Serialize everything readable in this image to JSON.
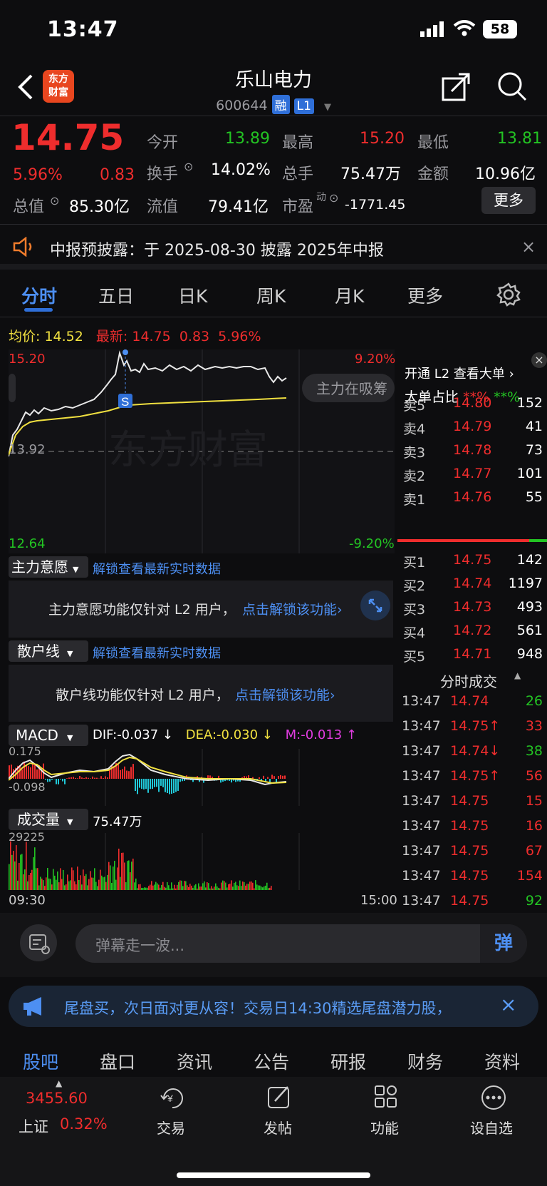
{
  "status": {
    "time": "13:47",
    "battery": "58"
  },
  "header": {
    "title": "乐山电力",
    "code": "600644",
    "tag1": "融",
    "tag2": "L1"
  },
  "quote": {
    "price": "14.75",
    "pct": "5.96%",
    "chg": "0.83",
    "open_label": "今开",
    "open": "13.89",
    "high_label": "最高",
    "high": "15.20",
    "low_label": "最低",
    "low": "13.81",
    "turnover_label": "换手",
    "turnover": "14.02%",
    "vol_label": "总手",
    "vol": "75.47万",
    "amt_label": "金额",
    "amt": "10.96亿",
    "mcap_label": "总值",
    "mcap": "85.30亿",
    "float_label": "流值",
    "float": "79.41亿",
    "pe_label": "市盈",
    "pe_sup": "动",
    "pe": "-1771.45",
    "more": "更多"
  },
  "notice": {
    "text": "中报预披露：于 2025-08-30 披露 2025年中报"
  },
  "tabs": [
    "分时",
    "五日",
    "日K",
    "周K",
    "月K",
    "更多"
  ],
  "chartinfo": {
    "avg_label": "均价:",
    "avg": "14.52",
    "last_label": "最新:",
    "last": "14.75",
    "chg": "0.83",
    "pct": "5.96%",
    "y_high": "15.20",
    "y_low": "12.64",
    "y_mid": "13.92",
    "pct_high": "9.20%",
    "pct_low": "-9.20%",
    "overlay": "主力在吸筹",
    "watermark": "东方财富",
    "s_marker": "S"
  },
  "zhuli": {
    "label": "主力意愿",
    "unlock": "解锁查看最新实时数据",
    "msg": "主力意愿功能仅针对 L2 用户，",
    "link": "点击解锁该功能"
  },
  "sanhu": {
    "label": "散户线",
    "unlock": "解锁查看最新实时数据",
    "msg": "散户线功能仅针对 L2 用户，",
    "link": "点击解锁该功能"
  },
  "macd": {
    "label": "MACD",
    "dif": "DIF:-0.037 ↓",
    "dea": "DEA:-0.030 ↓",
    "m": "M:-0.013 ↑",
    "top": "0.175",
    "bottom": "-0.098"
  },
  "volume": {
    "label": "成交量",
    "value": "75.47万",
    "top": "29225",
    "start": "09:30",
    "end": "15:00"
  },
  "l2": {
    "open": "开通 L2 查看大单",
    "big": "大单占比",
    "stars_red": "**%",
    "stars_green": "**%"
  },
  "asks": [
    {
      "l": "卖5",
      "p": "14.80",
      "v": "152"
    },
    {
      "l": "卖4",
      "p": "14.79",
      "v": "41"
    },
    {
      "l": "卖3",
      "p": "14.78",
      "v": "73"
    },
    {
      "l": "卖2",
      "p": "14.77",
      "v": "101"
    },
    {
      "l": "卖1",
      "p": "14.76",
      "v": "55"
    }
  ],
  "bids": [
    {
      "l": "买1",
      "p": "14.75",
      "v": "142"
    },
    {
      "l": "买2",
      "p": "14.74",
      "v": "1197"
    },
    {
      "l": "买3",
      "p": "14.73",
      "v": "493"
    },
    {
      "l": "买4",
      "p": "14.72",
      "v": "561"
    },
    {
      "l": "买5",
      "p": "14.71",
      "v": "948"
    }
  ],
  "ticks_title": "分时成交",
  "ticks": [
    {
      "t": "13:47",
      "p": "14.74",
      "v": "26",
      "c": "green"
    },
    {
      "t": "13:47",
      "p": "14.75↑",
      "v": "33",
      "c": "red"
    },
    {
      "t": "13:47",
      "p": "14.74↓",
      "v": "38",
      "c": "green"
    },
    {
      "t": "13:47",
      "p": "14.75↑",
      "v": "56",
      "c": "red"
    },
    {
      "t": "13:47",
      "p": "14.75",
      "v": "15",
      "c": "red"
    },
    {
      "t": "13:47",
      "p": "14.75",
      "v": "16",
      "c": "red"
    },
    {
      "t": "13:47",
      "p": "14.75",
      "v": "67",
      "c": "red"
    },
    {
      "t": "13:47",
      "p": "14.75",
      "v": "154",
      "c": "red"
    },
    {
      "t": "13:47",
      "p": "14.75",
      "v": "92",
      "c": "green"
    }
  ],
  "danmu": {
    "placeholder": "弹幕走一波...",
    "send": "弹"
  },
  "promo": {
    "text": "尾盘买，次日面对更从容！交易日14:30精选尾盘潜力股，"
  },
  "sections": [
    "股吧",
    "盘口",
    "资讯",
    "公告",
    "研报",
    "财务",
    "资料"
  ],
  "bottom": {
    "index_value": "3455.60",
    "index_name": "上证",
    "index_pct": "0.32%",
    "trade": "交易",
    "post": "发帖",
    "func": "功能",
    "watch": "设自选"
  }
}
